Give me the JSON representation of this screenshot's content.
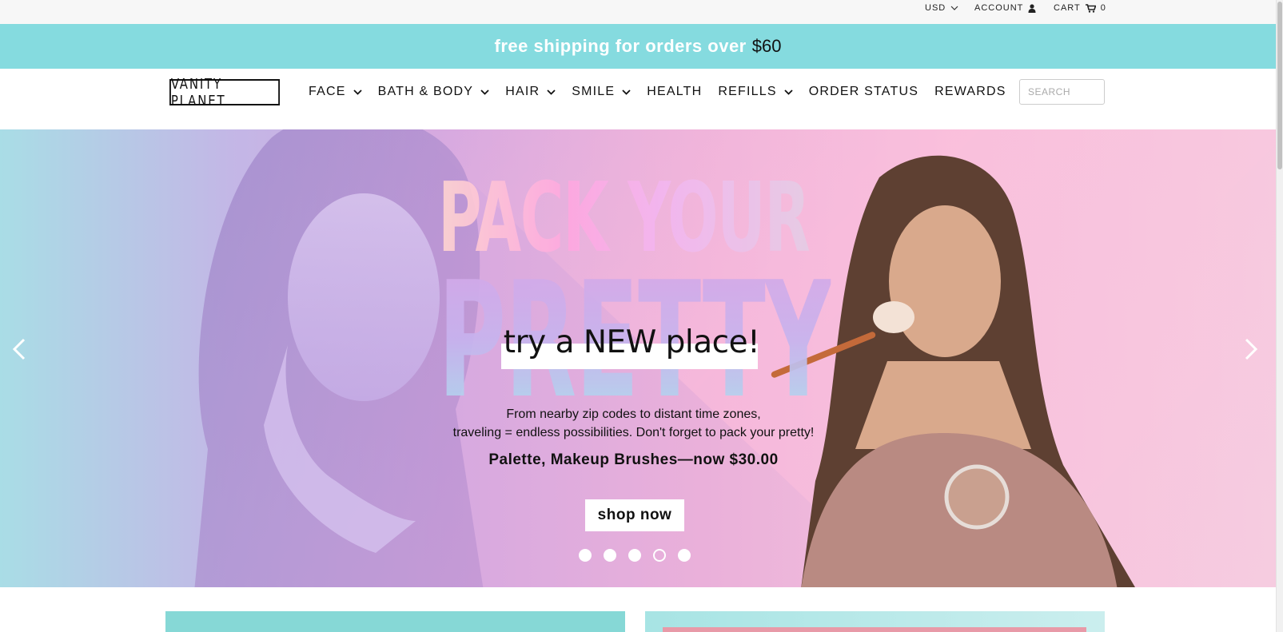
{
  "utility_bar": {
    "currency": "USD",
    "account_label": "ACCOUNT",
    "cart_label": "CART",
    "cart_count": "0"
  },
  "announcement": {
    "message": "free shipping for orders over",
    "amount": "$60",
    "background": "#85dbdf"
  },
  "header": {
    "logo_text": "VANITY PLANET",
    "nav": [
      {
        "label": "FACE",
        "has_dropdown": true
      },
      {
        "label": "BATH & BODY",
        "has_dropdown": true
      },
      {
        "label": "HAIR",
        "has_dropdown": true
      },
      {
        "label": "SMILE",
        "has_dropdown": true
      },
      {
        "label": "HEALTH",
        "has_dropdown": false
      },
      {
        "label": "REFILLS",
        "has_dropdown": true
      },
      {
        "label": "ORDER STATUS",
        "has_dropdown": false
      },
      {
        "label": "REWARDS",
        "has_dropdown": false
      }
    ],
    "search_placeholder": "SEARCH"
  },
  "hero": {
    "headline_top": "PACK YOUR",
    "headline_bottom": "PRETTY",
    "tagline": "try a NEW place!",
    "description_line1": "From nearby zip codes to distant time zones,",
    "description_line2": "traveling = endless possibilities. Don't forget to pack your pretty!",
    "promo": "Palette, Makeup Brushes—now $30.00",
    "cta_label": "shop now",
    "slide_count": 5,
    "active_slide": 4
  },
  "icons": {
    "currency_dropdown": "chevron-down-icon",
    "account": "user-icon",
    "cart": "cart-icon",
    "prev": "chevron-left-icon",
    "next": "chevron-right-icon"
  }
}
